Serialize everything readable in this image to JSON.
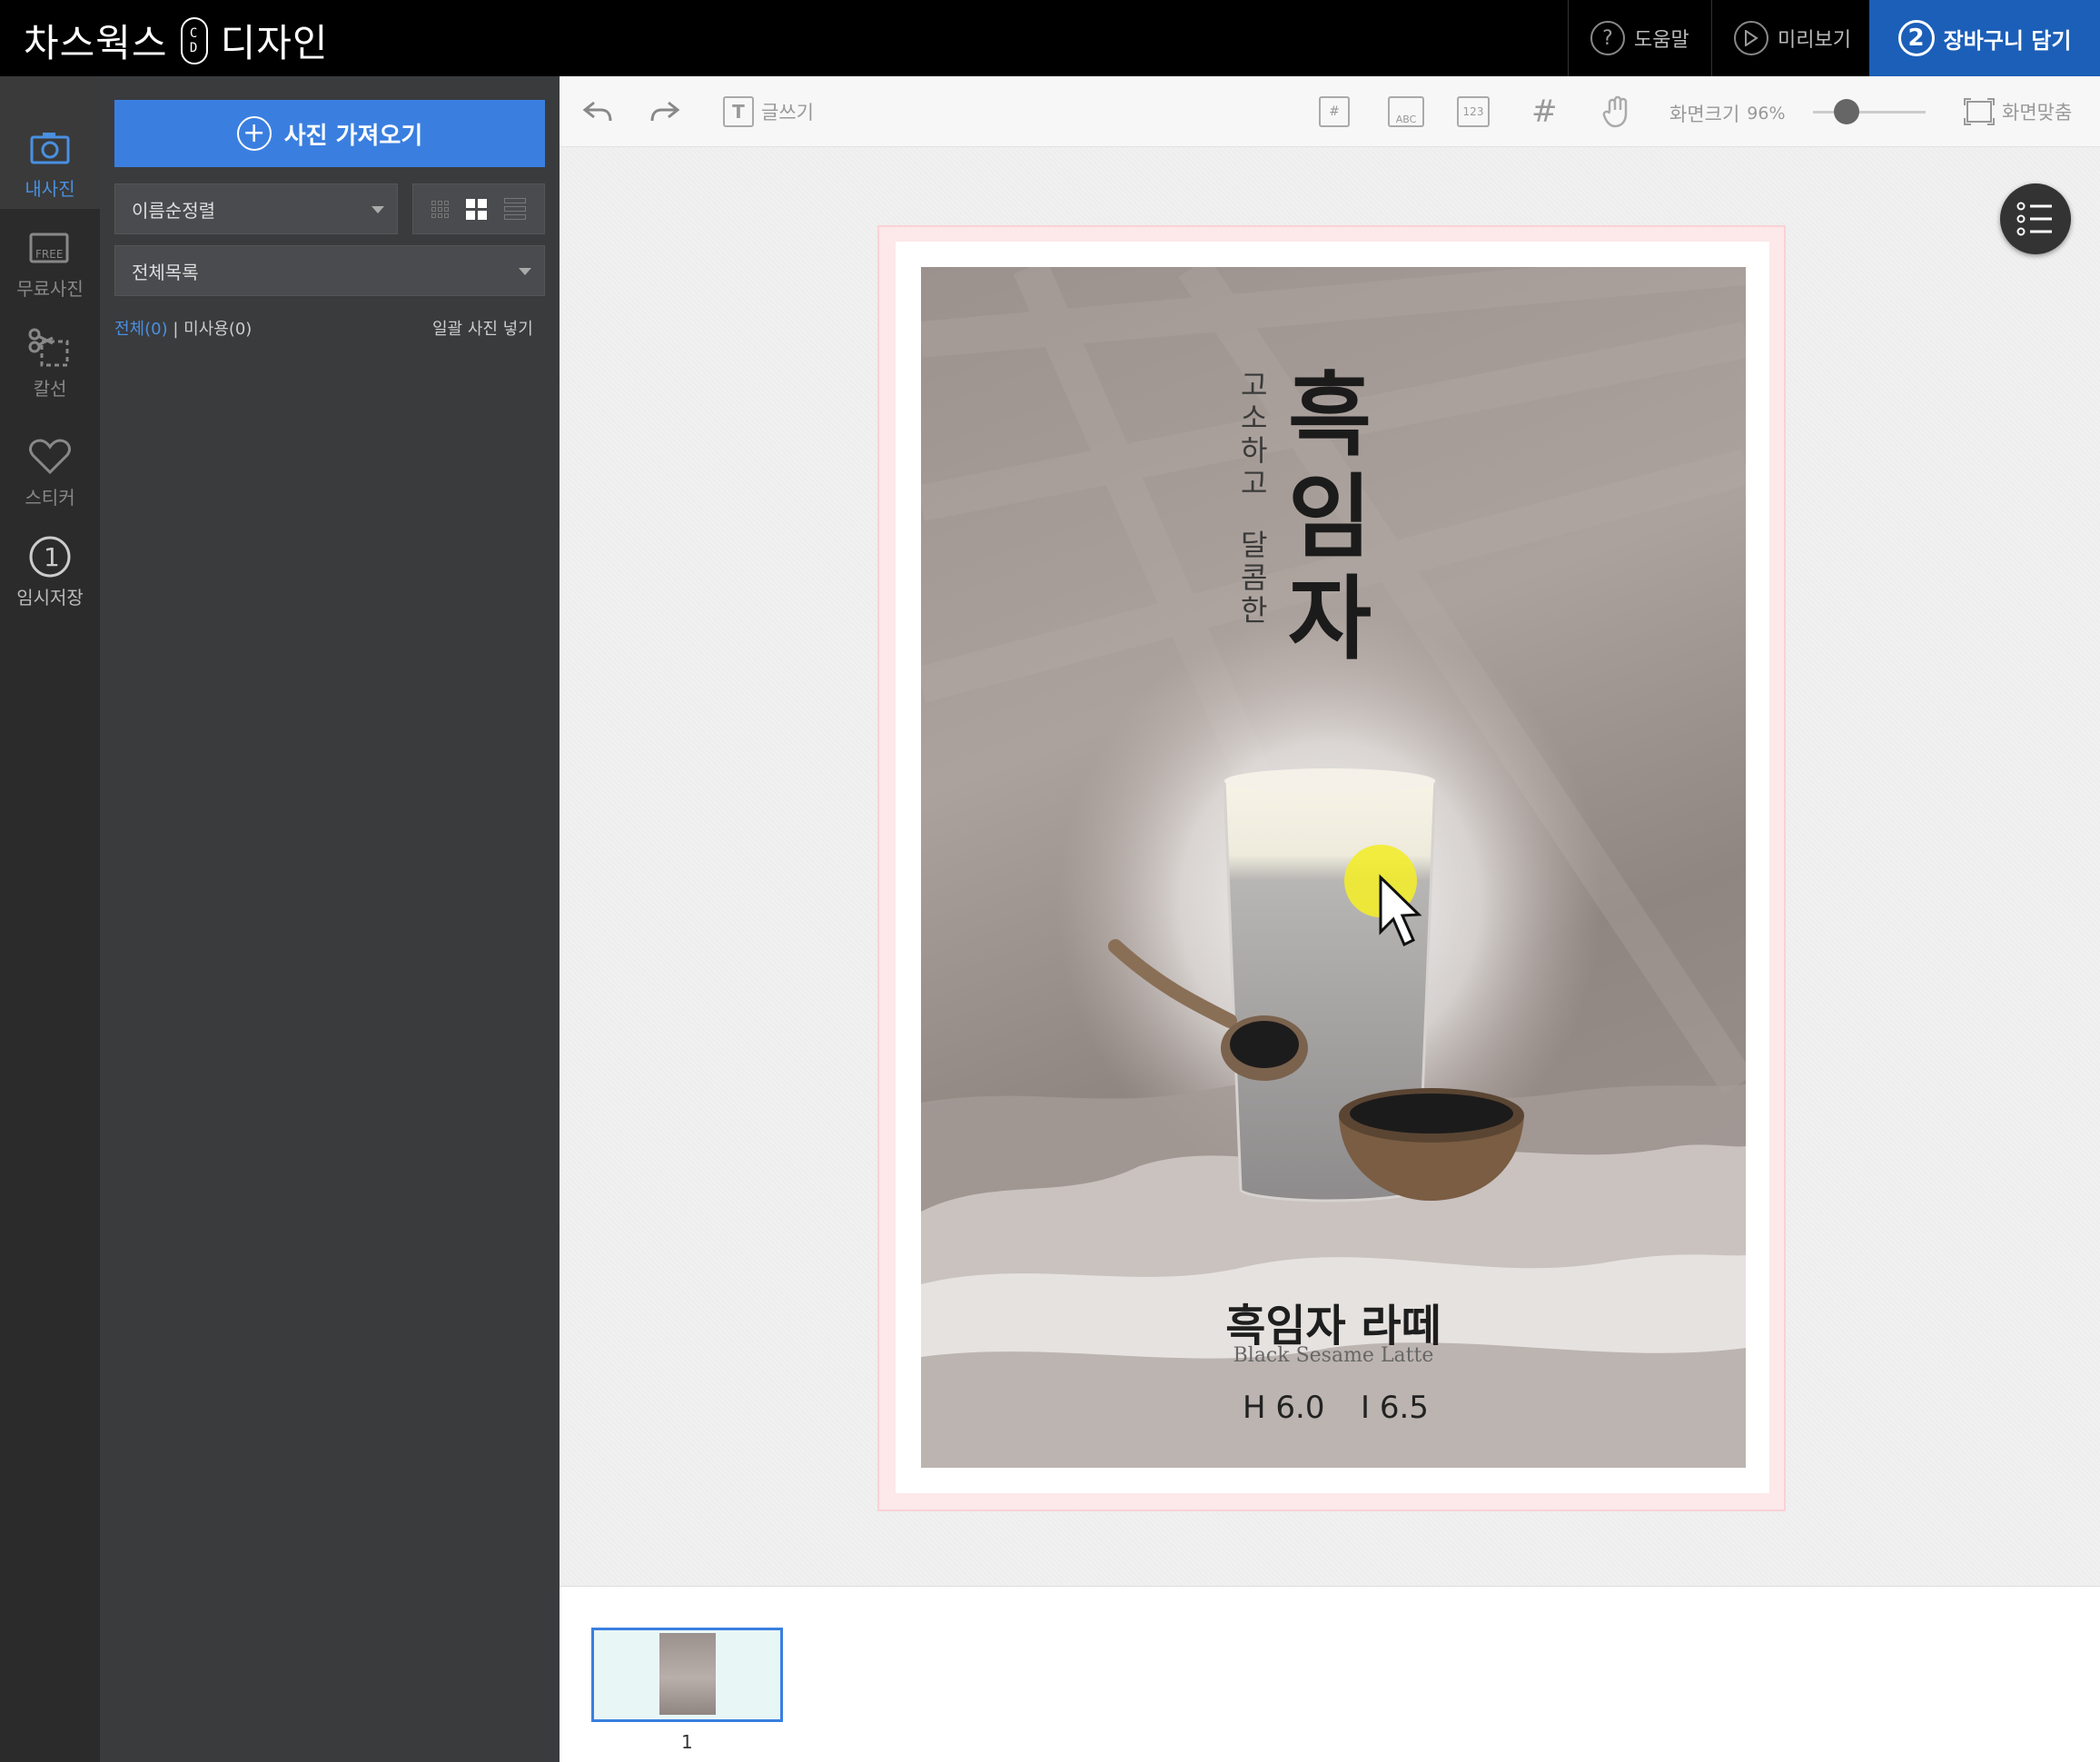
{
  "header": {
    "brand_left": "차스웍스",
    "brand_pill_top": "C",
    "brand_pill_bottom": "D",
    "brand_right": "디자인",
    "help_label": "도움말",
    "preview_label": "미리보기",
    "cart_step": "2",
    "cart_label": "장바구니 담기"
  },
  "rail": {
    "items": [
      {
        "label": "내사진",
        "icon": "camera-icon"
      },
      {
        "label": "무료사진",
        "icon": "free-photo-icon"
      },
      {
        "label": "칼선",
        "icon": "scissors-icon"
      },
      {
        "label": "스티커",
        "icon": "heart-icon"
      },
      {
        "label": "임시저장",
        "icon": "temp-save-icon",
        "badge": "1"
      }
    ]
  },
  "panel": {
    "import_label": "사진 가져오기",
    "sort_value": "이름순정렬",
    "filter_value": "전체목록",
    "count_all": "전체(0)",
    "count_sep": " | ",
    "count_unused": "미사용(0)",
    "bulk_insert": "일괄 사진 넣기"
  },
  "toolbar": {
    "write_label": "글쓰기",
    "abc_label": "ABC",
    "num_label": "123",
    "zoom_label": "화면크기",
    "zoom_value": "96%",
    "zoom_fraction": 0.3,
    "fit_label": "화면맞춤"
  },
  "artwork": {
    "title_vertical": [
      "흑",
      "임",
      "자"
    ],
    "subtitle_vertical_1": [
      "고",
      "소",
      "하",
      "고"
    ],
    "subtitle_vertical_2": [
      "달",
      "콤",
      "한"
    ],
    "product_ko": "흑임자 라떼",
    "product_en": "Black Sesame Latte",
    "price_h": "H 6.0",
    "price_i": "I 6.5"
  },
  "filmstrip": {
    "page_number": "1"
  },
  "colors": {
    "accent": "#3a7fe0",
    "cart_bg": "#1c5fb8",
    "panel_bg": "#3a3b3d"
  }
}
